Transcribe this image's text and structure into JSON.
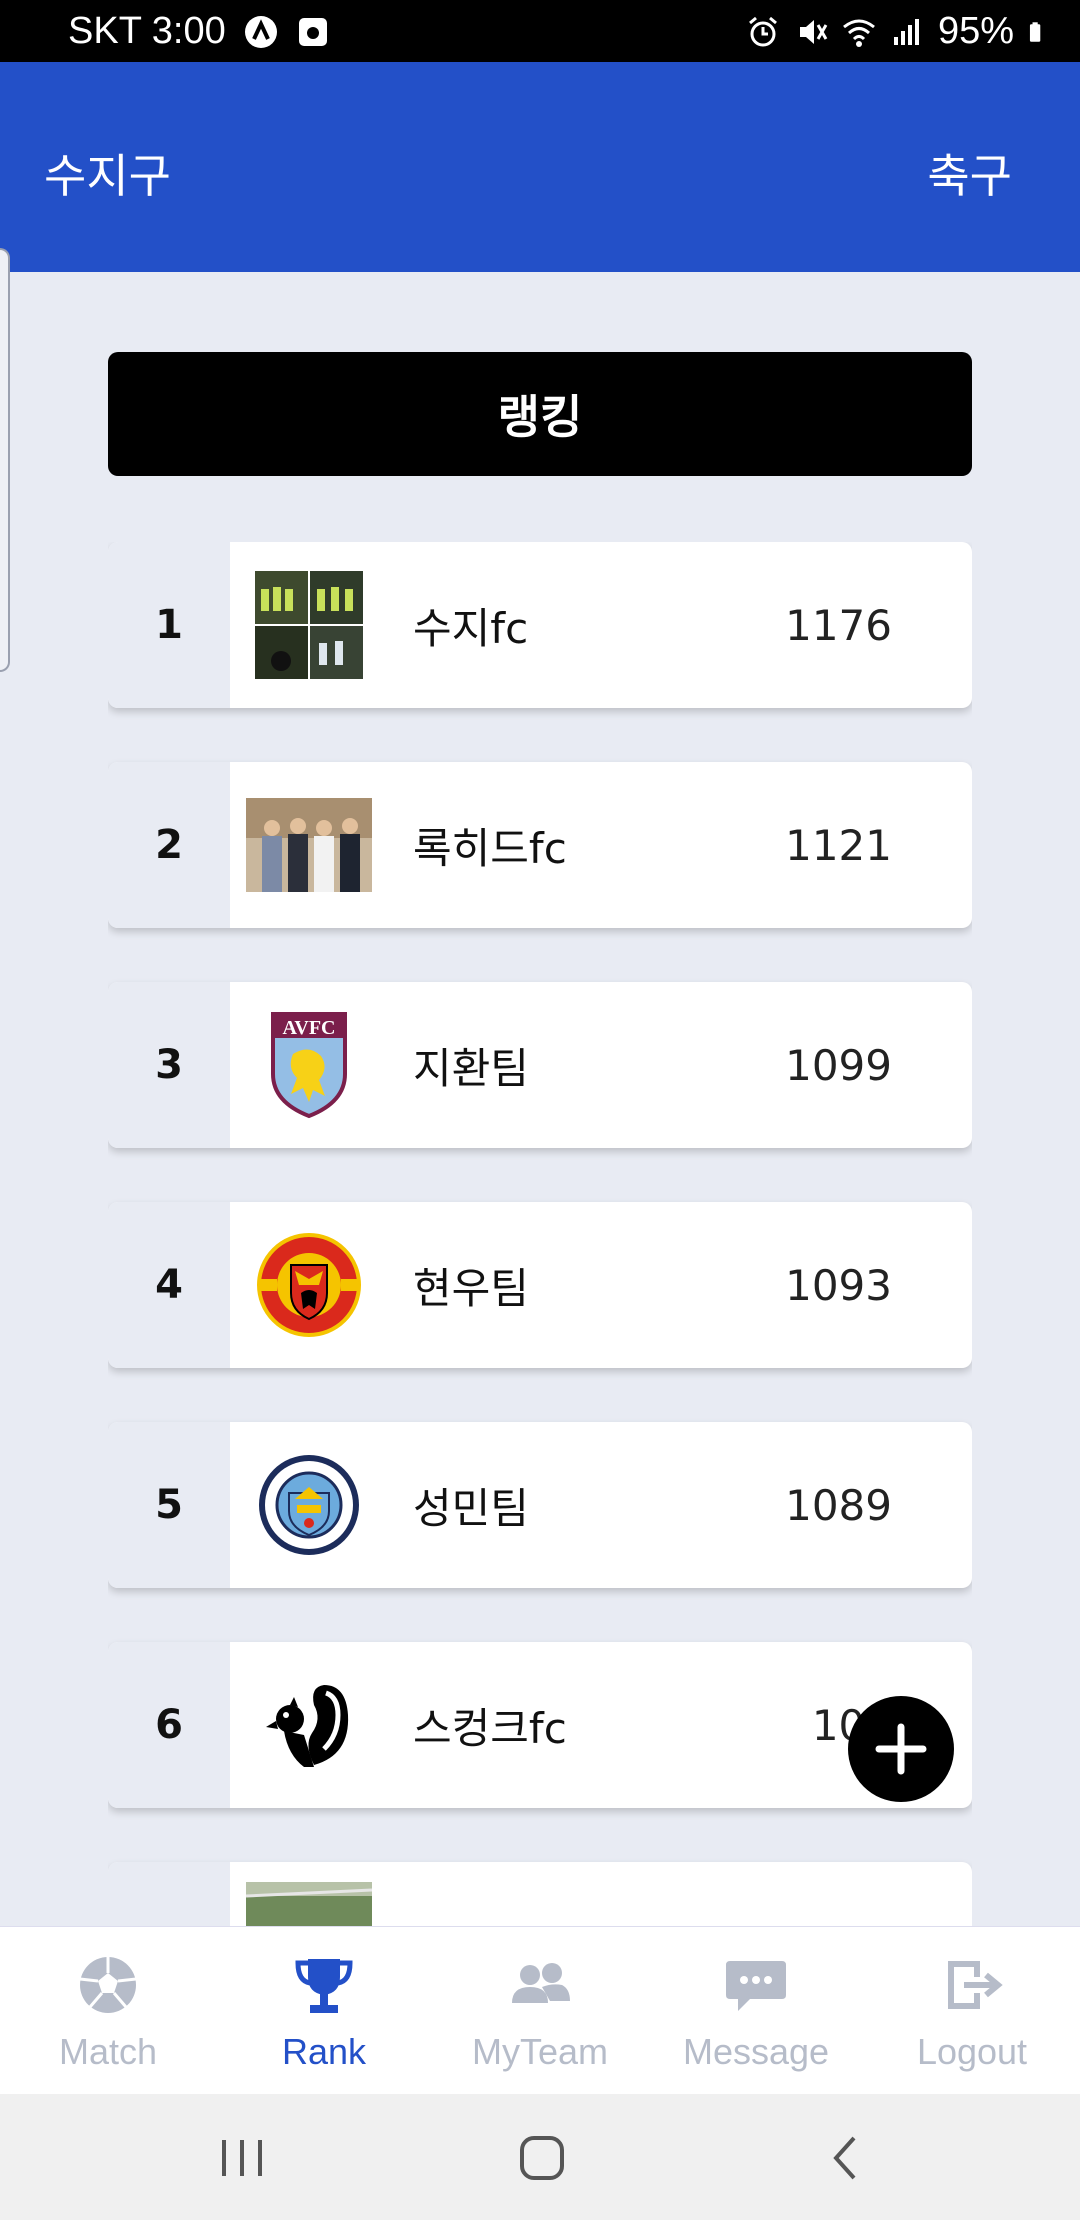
{
  "status_bar": {
    "carrier_time": "SKT 3:00",
    "battery": "95%",
    "icons_left": [
      "ride-icon",
      "media-icon"
    ],
    "icons_right": [
      "alarm-icon",
      "mute-icon",
      "wifi-icon",
      "signal-icon",
      "battery-icon"
    ]
  },
  "header": {
    "region": "수지구",
    "sport": "축구",
    "color": "#2350c8"
  },
  "banner": {
    "title": "랭킹"
  },
  "teams": [
    {
      "rank": "1",
      "name": "수지fc",
      "points": "1176",
      "logo": "team-photo"
    },
    {
      "rank": "2",
      "name": "록히드fc",
      "points": "1121",
      "logo": "team-photo"
    },
    {
      "rank": "3",
      "name": "지환팀",
      "points": "1099",
      "logo": "avfc-crest"
    },
    {
      "rank": "4",
      "name": "현우팀",
      "points": "1093",
      "logo": "man-united-crest"
    },
    {
      "rank": "5",
      "name": "성민팀",
      "points": "1089",
      "logo": "man-city-crest"
    },
    {
      "rank": "6",
      "name": "스컹크fc",
      "points": "107",
      "logo": "skunk-logo"
    }
  ],
  "crest_texts": {
    "avfc": "AVFC"
  },
  "bottom_nav": {
    "items": [
      {
        "label": "Match",
        "icon": "soccer-ball-icon"
      },
      {
        "label": "Rank",
        "icon": "trophy-icon"
      },
      {
        "label": "MyTeam",
        "icon": "users-icon"
      },
      {
        "label": "Message",
        "icon": "chat-icon"
      },
      {
        "label": "Logout",
        "icon": "logout-icon"
      }
    ],
    "active": "Rank"
  },
  "colors": {
    "accent": "#2350c8",
    "inactive": "#b6bcc9",
    "page_bg": "#e8ebf3"
  }
}
